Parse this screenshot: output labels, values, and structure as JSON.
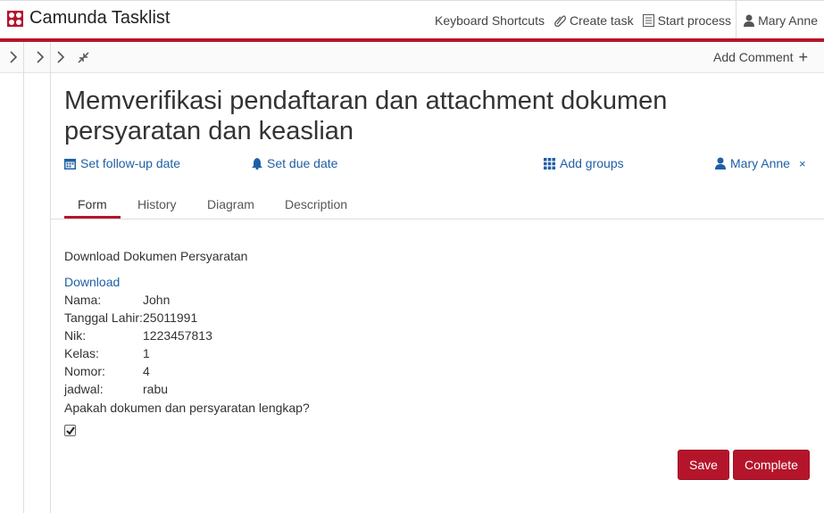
{
  "header": {
    "app_title": "Camunda Tasklist",
    "keyboard_shortcuts": "Keyboard Shortcuts",
    "create_task": "Create task",
    "start_process": "Start process",
    "user_name": "Mary Anne",
    "accent_color": "#b5152b"
  },
  "toolbar": {
    "add_comment": "Add Comment",
    "add_comment_icon": "+"
  },
  "task": {
    "title": "Memverifikasi pendaftaran dan attachment dokumen persyaratan dan keaslian",
    "follow_up": "Set follow-up date",
    "due_date": "Set due date",
    "add_groups": "Add groups",
    "assignee": "Mary Anne",
    "remove_assignee": "×"
  },
  "tabs": [
    {
      "label": "Form"
    },
    {
      "label": "History"
    },
    {
      "label": "Diagram"
    },
    {
      "label": "Description"
    }
  ],
  "form": {
    "heading": "Download Dokumen Persyaratan",
    "download_link": "Download",
    "fields": [
      {
        "label": "Nama:",
        "value": "John"
      },
      {
        "label": "Tanggal Lahir:",
        "value": "25011991"
      },
      {
        "label": "Nik:",
        "value": "1223457813"
      },
      {
        "label": "Kelas:",
        "value": "1"
      },
      {
        "label": "Nomor:",
        "value": "4"
      },
      {
        "label": "jadwal:",
        "value": "rabu"
      }
    ],
    "question": "Apakah dokumen dan persyaratan lengkap?",
    "checkbox_checked": true,
    "save_label": "Save",
    "complete_label": "Complete"
  }
}
